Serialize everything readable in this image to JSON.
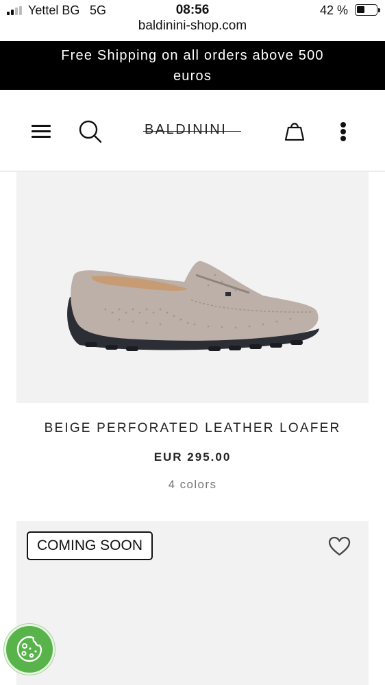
{
  "status_bar": {
    "carrier": "Yettel BG",
    "network": "5G",
    "time": "08:56",
    "battery": "42 %",
    "battery_level": 0.42
  },
  "browser": {
    "url": "baldinini-shop.com"
  },
  "promo": {
    "text": "Free Shipping on all orders above 500 euros"
  },
  "header": {
    "logo": "BALDININI",
    "icons": [
      "menu-icon",
      "search-icon",
      "shopping-bag-icon",
      "more-icon"
    ]
  },
  "product": {
    "name": "BEIGE PERFORATED LEATHER LOAFER",
    "price": "EUR 295.00",
    "colors": "4 colors"
  },
  "next_product": {
    "badge": "COMING SOON",
    "icon": "heart-icon"
  },
  "cookie": {
    "icon": "cookie-icon",
    "color": "#58b34a"
  }
}
